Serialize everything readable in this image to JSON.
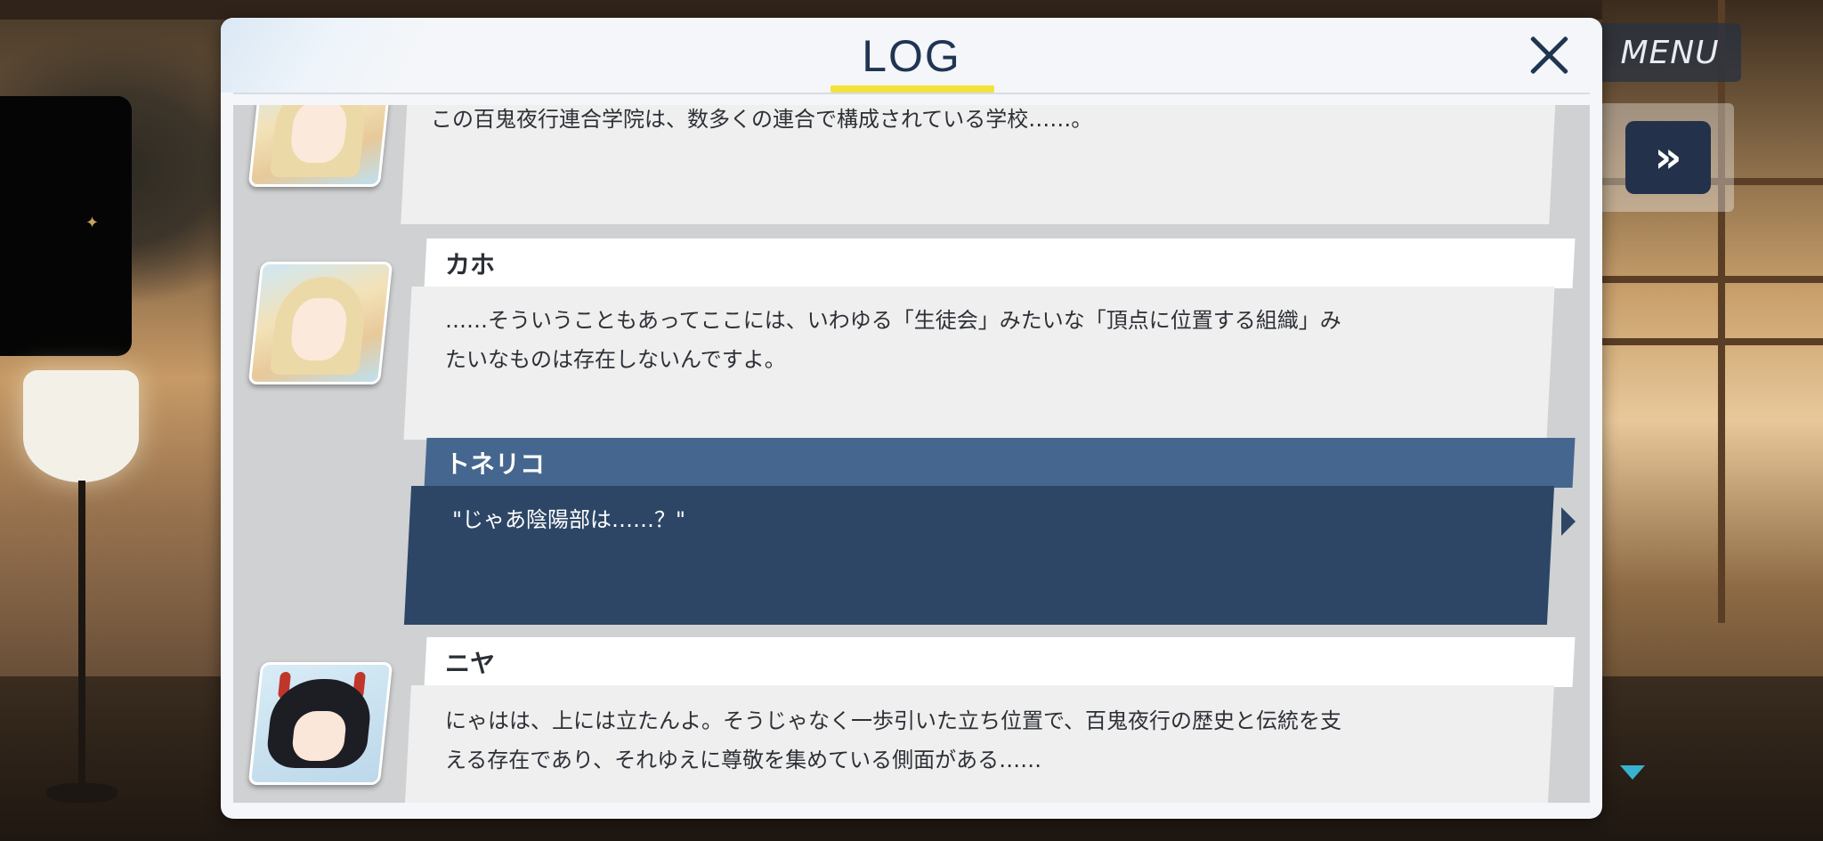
{
  "header": {
    "title": "LOG",
    "menu_label": "MENU",
    "skip_glyph": "»"
  },
  "colors": {
    "title": "#1f3552",
    "title_underline": "#f1e33a",
    "selected_name_bar": "#45668e",
    "selected_message_box": "#2d4666",
    "scroll_indicator": "#39b2cf"
  },
  "icons": {
    "close": "close-icon",
    "skip": "fast-forward-icon",
    "scroll": "scroll-down-icon"
  },
  "log_entries": [
    {
      "speaker": "",
      "avatar": "kaho-portrait",
      "text": "この百鬼夜行連合学院は、数多くの連合で構成されている学校……。"
    },
    {
      "speaker": "カホ",
      "avatar": "kaho-portrait",
      "text": "……そういうこともあってここには、いわゆる「生徒会」みたいな「頂点に位置する組織」み\nたいなものは存在しないんですよ。"
    },
    {
      "speaker": "トネリコ",
      "avatar": "",
      "selected": true,
      "text": "\"じゃあ陰陽部は……？\""
    },
    {
      "speaker": "ニヤ",
      "avatar": "niya-portrait",
      "text": "にゃはは、上には立たんよ。そうじゃなく一歩引いた立ち位置で、百鬼夜行の歴史と伝統を支\nえる存在であり、それゆえに尊敬を集めている側面がある……"
    }
  ]
}
